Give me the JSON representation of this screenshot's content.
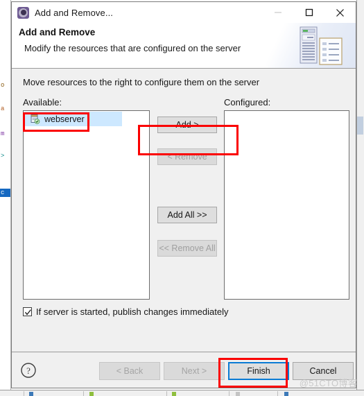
{
  "window": {
    "title": "Add and Remove...",
    "icon": "gear-icon",
    "controls": {
      "minimize": "minimize-icon",
      "maximize": "maximize-icon",
      "close": "close-icon"
    }
  },
  "banner": {
    "title": "Add and Remove",
    "subtitle": "Modify the resources that are configured on the server",
    "art": "server-and-document-illustration"
  },
  "body": {
    "instruction": "Move resources to the right to configure them on the server",
    "available": {
      "label": "Available:",
      "items": [
        {
          "name": "webserver",
          "icon": "web-project-icon",
          "selected": true
        }
      ]
    },
    "configured": {
      "label": "Configured:",
      "items": []
    },
    "transfer_buttons": [
      {
        "label": "Add >",
        "enabled": true
      },
      {
        "label": "< Remove",
        "enabled": false
      },
      {
        "label": "Add All >>",
        "enabled": true
      },
      {
        "label": "<< Remove All",
        "enabled": false
      }
    ],
    "publish_checkbox": {
      "label": "If server is started, publish changes immediately",
      "checked": true
    }
  },
  "footer": {
    "help": "help-icon",
    "buttons": [
      {
        "label": "< Back",
        "enabled": false,
        "focused": false
      },
      {
        "label": "Next >",
        "enabled": false,
        "focused": false
      },
      {
        "label": "Finish",
        "enabled": true,
        "focused": true
      },
      {
        "label": "Cancel",
        "enabled": true,
        "focused": false
      }
    ]
  },
  "annotations": {
    "color": "#fb0000",
    "regions": [
      "webserver-list-item",
      "add-button",
      "finish-button"
    ]
  },
  "watermark": "@51CTO博客",
  "background": {
    "code_lines": [
      "o",
      "a",
      "m",
      ">"
    ],
    "selected_line": "c"
  }
}
